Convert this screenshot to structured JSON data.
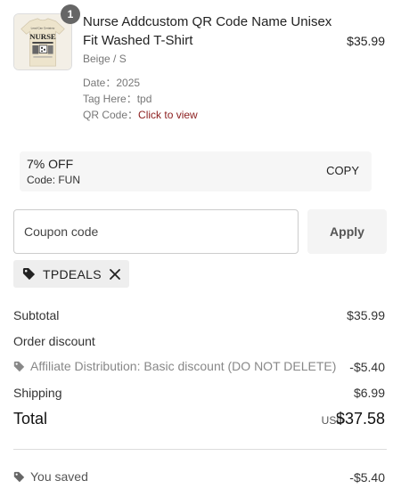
{
  "product": {
    "quantity": "1",
    "title": "Nurse Addcustom QR Code Name Unisex Fit Washed T-Shirt",
    "price": "$35.99",
    "variant": "Beige / S",
    "properties": [
      {
        "label": "Date：",
        "value": "2025"
      },
      {
        "label": "Tag Here：",
        "value": "tpd"
      },
      {
        "label": "QR Code：",
        "value": "Click to view"
      }
    ],
    "shirt_text": {
      "top": "Lead Can Certainty",
      "main": "NURSE"
    }
  },
  "promo": {
    "title": "7% OFF",
    "code_line": "Code: FUN",
    "copy_label": "COPY"
  },
  "coupon": {
    "placeholder": "Coupon code",
    "value": "",
    "apply_label": "Apply",
    "applied_tag": "TPDEALS"
  },
  "summary": {
    "subtotal_label": "Subtotal",
    "subtotal_value": "$35.99",
    "order_discount_label": "Order discount",
    "affiliate_label": "Affiliate Distribution: Basic discount (DO NOT DELETE)",
    "affiliate_value": "-$5.40",
    "shipping_label": "Shipping",
    "shipping_value": "$6.99",
    "total_label": "Total",
    "currency": "USD",
    "total_value": "$37.58",
    "saved_label": "You saved",
    "saved_value": "-$5.40"
  },
  "colors": {
    "link": "#8b1d1d",
    "shirt": "#ede4cc"
  }
}
